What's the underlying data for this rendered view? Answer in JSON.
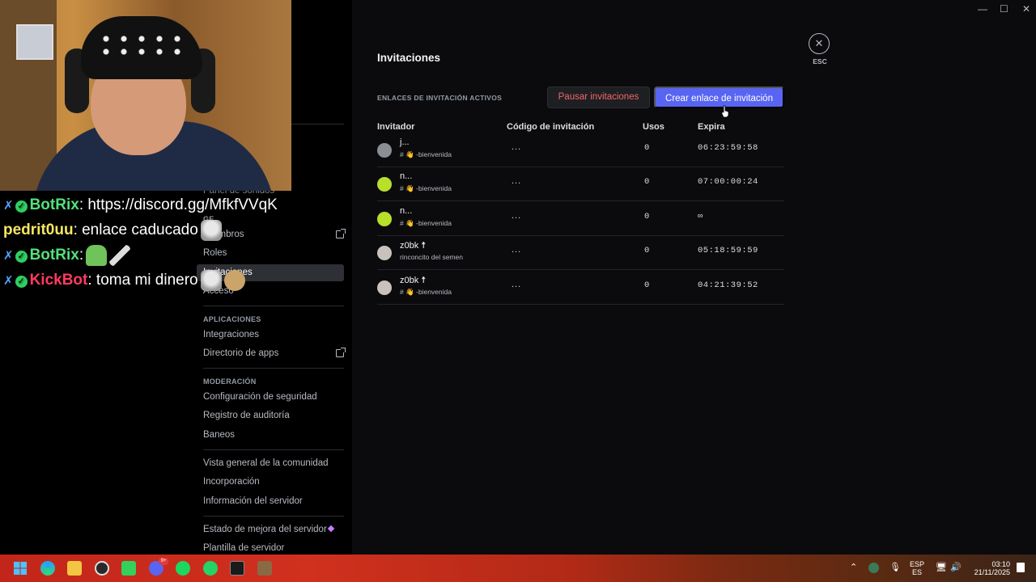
{
  "sidebar": {
    "partial_item": "Panel de sonidos",
    "section_members_head": "GE",
    "items_members": [
      {
        "label": "Miembros",
        "external": true
      },
      {
        "label": "Roles"
      },
      {
        "label": "Invitaciones",
        "active": true
      },
      {
        "label": "Acceso"
      }
    ],
    "section_apps_head": "APLICACIONES",
    "items_apps": [
      {
        "label": "Integraciones"
      },
      {
        "label": "Directorio de apps",
        "external": true
      }
    ],
    "section_mod_head": "MODERACIÓN",
    "items_mod": [
      {
        "label": "Configuración de seguridad"
      },
      {
        "label": "Registro de auditoría"
      },
      {
        "label": "Baneos"
      }
    ],
    "items_community": [
      {
        "label": "Vista general de la comunidad"
      },
      {
        "label": "Incorporación"
      },
      {
        "label": "Información del servidor"
      }
    ],
    "items_bottom": [
      {
        "label": "Estado de mejora del servidor"
      },
      {
        "label": "Plantilla de servidor"
      }
    ]
  },
  "chat": [
    {
      "user": "BotRix",
      "message": ": https://discord.gg/MfkfVVqK",
      "color": "#53e07a"
    },
    {
      "user": "pedrit0uu",
      "message": ": enlace caducado",
      "color": "#f5e663"
    },
    {
      "user": "BotRix",
      "message": ":",
      "color": "#53e07a"
    },
    {
      "user": "KickBot",
      "message": ": toma mi dinero",
      "color": "#ff3a5f"
    }
  ],
  "main": {
    "title": "Invitaciones",
    "section_head": "ENLACES DE INVITACIÓN ACTIVOS",
    "pause_button": "Pausar invitaciones",
    "create_button": "Crear enlace de invitación",
    "close_label": "ESC",
    "columns": [
      "Invitador",
      "Código de invitación",
      "Usos",
      "Expira"
    ],
    "invites": [
      {
        "inviter": "j...",
        "channel": "# 👋 -bienvenida",
        "code": "...",
        "uses": "0",
        "expires": "06:23:59:58",
        "avatar_color": "#8a8f96"
      },
      {
        "inviter": "n...",
        "channel": "# 👋 -bienvenida",
        "code": "...",
        "uses": "0",
        "expires": "07:00:00:24",
        "avatar_color": "#b6e02a"
      },
      {
        "inviter": "n...",
        "channel": "# 👋 -bienvenida",
        "code": "...",
        "uses": "0",
        "expires": "∞",
        "avatar_color": "#b6e02a"
      },
      {
        "inviter": "z0bk ☨",
        "channel": "rinconcito del semen",
        "code": "...",
        "uses": "0",
        "expires": "05:18:59:59",
        "avatar_color": "#c7c2bb"
      },
      {
        "inviter": "z0bk ☨",
        "channel": "# 👋 -bienvenida",
        "code": "...",
        "uses": "0",
        "expires": "04:21:39:52",
        "avatar_color": "#c7c2bb"
      }
    ]
  },
  "window_controls": {
    "minimize": "—",
    "maximize": "☐",
    "close": "✕"
  },
  "taskbar": {
    "discord_badge": "9+",
    "lang_top": "ESP",
    "lang_bottom": "ES",
    "time": "03:10",
    "date": "21/11/2025",
    "accent": "#5865f2"
  }
}
